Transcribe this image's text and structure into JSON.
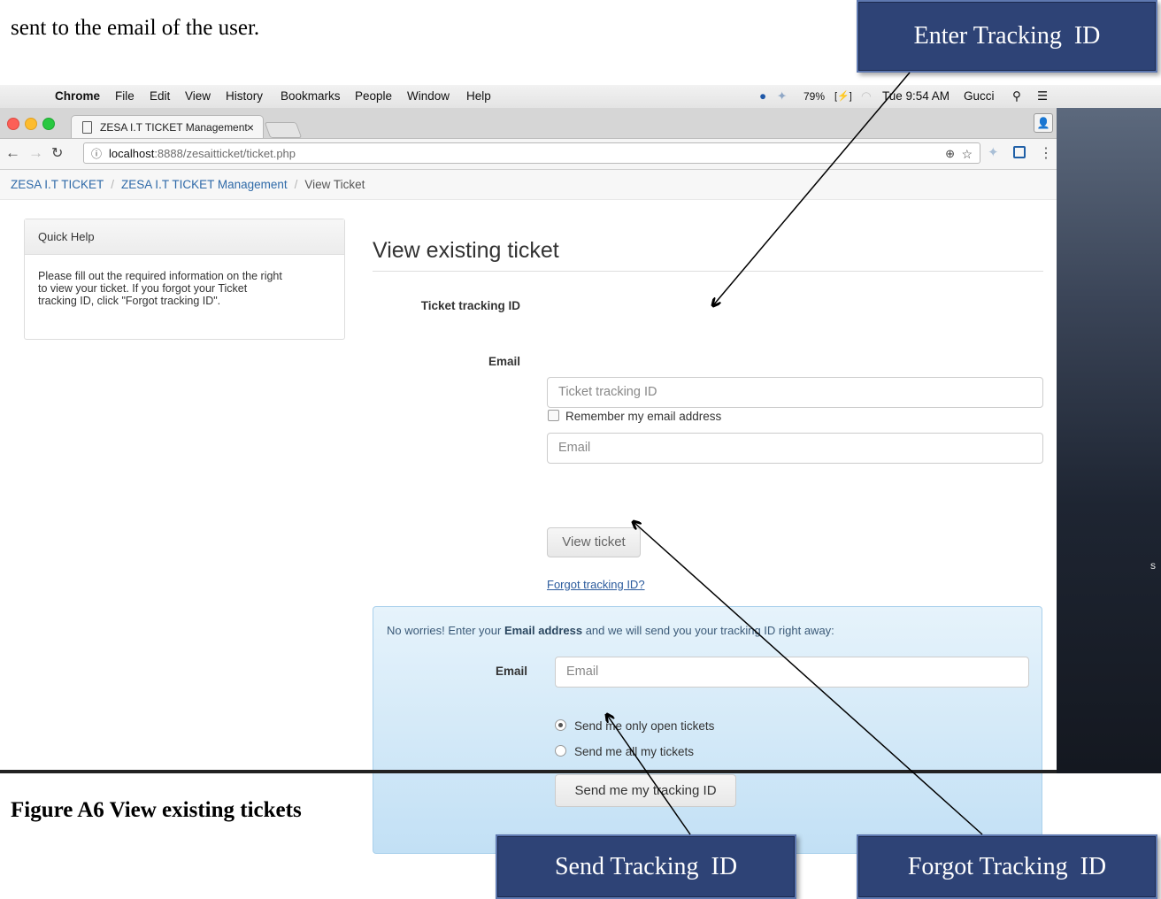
{
  "doc_text": "sent to the email of the user.",
  "caption": "Figure A6 View existing tickets",
  "callouts": {
    "enter_tracking": "Enter Tracking  ID",
    "send_tracking": "Send Tracking  ID",
    "forgot_tracking": "Forgot Tracking  ID"
  },
  "menubar": {
    "apple": "",
    "app": "Chrome",
    "items": [
      "File",
      "Edit",
      "View",
      "History",
      "Bookmarks",
      "People",
      "Window",
      "Help"
    ],
    "battery": "79%",
    "clock": "Tue 9:54 AM",
    "user": "Gucci"
  },
  "browser": {
    "tab_title": "ZESA I.T TICKET Management",
    "tab_close": "×",
    "url_host": "localhost",
    "url_rest": ":8888/zesaitticket/ticket.php"
  },
  "breadcrumb": {
    "home": "ZESA I.T TICKET",
    "section": "ZESA I.T TICKET Management",
    "current": "View Ticket",
    "separator": "/"
  },
  "quick_help": {
    "title": "Quick Help",
    "line1": "Please fill out the required information on the right",
    "line2": "to view your ticket. If you forgot your Ticket",
    "line3": "tracking ID, click \"Forgot tracking ID\"."
  },
  "form": {
    "heading": "View existing ticket",
    "tracking_label": "Ticket tracking ID",
    "tracking_placeholder": "Ticket tracking ID",
    "email_label": "Email",
    "email_placeholder": "Email",
    "remember_label": "Remember my email address",
    "view_button": "View ticket",
    "forgot_link": "Forgot tracking ID?"
  },
  "forgot_panel": {
    "msg_before": "No worries! Enter your ",
    "msg_bold": "Email address",
    "msg_after": " and we will send you your tracking ID right away:",
    "email_label": "Email",
    "email_placeholder": "Email",
    "radio_open": "Send me only open tickets",
    "radio_all": "Send me all my tickets",
    "send_button": "Send me my tracking ID"
  },
  "desktop_letter": "s"
}
